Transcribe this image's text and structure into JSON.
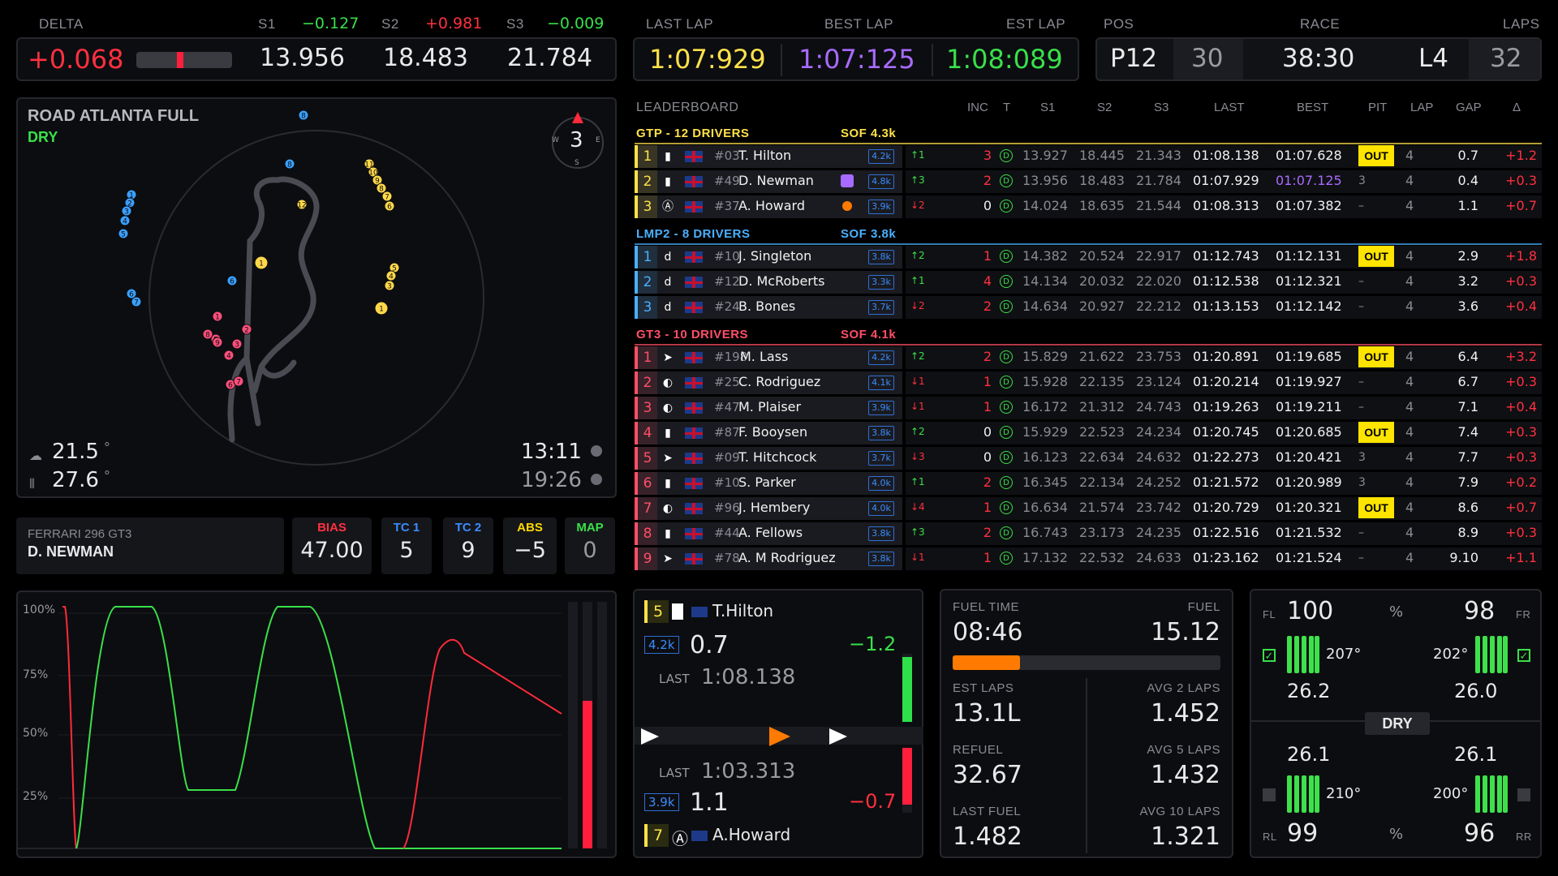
{
  "delta": {
    "label": "DELTA",
    "value": "+0.068",
    "s1_label": "S1",
    "s1_delta": "−0.127",
    "s2_label": "S2",
    "s2_delta": "+0.981",
    "s3_label": "S3",
    "s3_delta": "−0.009",
    "s1": "13.956",
    "s2": "18.483",
    "s3": "21.784"
  },
  "laps_box": {
    "last_label": "LAST LAP",
    "best_label": "BEST LAP",
    "est_label": "EST LAP",
    "last": "1:07:929",
    "best": "1:07:125",
    "est": "1:08:089"
  },
  "race_box": {
    "pos_label": "POS",
    "race_label": "RACE",
    "laps_label": "LAPS",
    "pos": "P12",
    "field": "30",
    "time": "38:30",
    "lap": "L4",
    "total_laps": "32"
  },
  "map": {
    "track": "ROAD ATLANTA FULL",
    "surface": "DRY",
    "compass_n": "N",
    "compass_w": "W",
    "compass_e": "E",
    "compass_s": "S",
    "compass_value": "3",
    "air_temp": "21.5",
    "track_temp": "27.6",
    "deg": "°",
    "clock": "13:11",
    "clock2": "19:26",
    "markers": [
      {
        "label": "8",
        "color": "#3aa0ff"
      },
      {
        "label": "8",
        "color": "#3aa0ff"
      },
      {
        "label": "1",
        "color": "#3aa0ff"
      },
      {
        "label": "2",
        "color": "#3aa0ff"
      },
      {
        "label": "3",
        "color": "#3aa0ff"
      },
      {
        "label": "4",
        "color": "#3aa0ff"
      },
      {
        "label": "5",
        "color": "#3aa0ff"
      },
      {
        "label": "6",
        "color": "#3aa0ff"
      },
      {
        "label": "7",
        "color": "#3aa0ff"
      },
      {
        "label": "6",
        "color": "#3aa0ff"
      },
      {
        "label": "12",
        "color": "#ffd84a"
      },
      {
        "label": "11",
        "color": "#ffd84a"
      },
      {
        "label": "10",
        "color": "#ffd84a"
      },
      {
        "label": "9",
        "color": "#ffd84a"
      },
      {
        "label": "8",
        "color": "#ffd84a"
      },
      {
        "label": "7",
        "color": "#ffd84a"
      },
      {
        "label": "6",
        "color": "#ffd84a"
      },
      {
        "label": "5",
        "color": "#ffd84a"
      },
      {
        "label": "4",
        "color": "#ffd84a"
      },
      {
        "label": "3",
        "color": "#ffd84a"
      },
      {
        "label": "1",
        "color": "#ffd84a"
      },
      {
        "label": "1",
        "color": "#ffd84a"
      },
      {
        "label": "1",
        "color": "#ff4f7b"
      },
      {
        "label": "2",
        "color": "#ff4f7b"
      },
      {
        "label": "3",
        "color": "#ff4f7b"
      },
      {
        "label": "4",
        "color": "#ff4f7b"
      },
      {
        "label": "5",
        "color": "#ff4f7b"
      },
      {
        "label": "6",
        "color": "#ff4f7b"
      },
      {
        "label": "7",
        "color": "#ff4f7b"
      },
      {
        "label": "8",
        "color": "#ff4f7b"
      },
      {
        "label": "9",
        "color": "#ff4f7b"
      }
    ]
  },
  "car": {
    "model": "FERRARI 296 GT3",
    "driver": "D. NEWMAN"
  },
  "settings": [
    {
      "label": "BIAS",
      "value": "47.00",
      "color": "#ff3040"
    },
    {
      "label": "TC 1",
      "value": "5",
      "color": "#3a8cff"
    },
    {
      "label": "TC 2",
      "value": "9",
      "color": "#3a8cff"
    },
    {
      "label": "ABS",
      "value": "−5",
      "color": "#ffd700"
    },
    {
      "label": "MAP",
      "value": "0",
      "color": "#39e04a"
    }
  ],
  "leaderboard": {
    "title": "LEADERBOARD",
    "cols": {
      "inc": "INC",
      "t": "T",
      "s1": "S1",
      "s2": "S2",
      "s3": "S3",
      "last": "LAST",
      "best": "BEST",
      "pit": "PIT",
      "lap": "LAP",
      "gap": "GAP",
      "delta": "Δ"
    },
    "classes": [
      {
        "name": "GTP - 12 DRIVERS",
        "sof": "SOF 4.3k",
        "color": "#ffe14a"
      },
      {
        "name": "LMP2 - 8 DRIVERS",
        "sof": "SOF 3.8k",
        "color": "#4ab0ff"
      },
      {
        "name": "GT3 - 10 DRIVERS",
        "sof": "SOF 4.1k",
        "color": "#ff4f68"
      }
    ],
    "rows": [
      {
        "cls": 0,
        "pos": "1",
        "brand": "▮",
        "num": "#03",
        "name": "T. Hilton",
        "lic": "4.2k",
        "pg": "↑1",
        "pgc": "up",
        "inc": "3",
        "incc": "#ff3040",
        "tyre": "D",
        "s1": "13.927",
        "s2": "18.445",
        "s3": "21.343",
        "last": "01:08.138",
        "best": "01:07.628",
        "pit": "OUT",
        "lap": "4",
        "gap": "0.7",
        "delta": "+1.2"
      },
      {
        "cls": 0,
        "pos": "2",
        "brand": "▮",
        "num": "#49",
        "name": "D. Newman",
        "lic": "4.8k",
        "pg": "↑3",
        "pgc": "up",
        "inc": "2",
        "incc": "#ff3040",
        "tyre": "D",
        "s1": "13.956",
        "s2": "18.483",
        "s3": "21.784",
        "last": "01:07.929",
        "best": "01:07.125",
        "pit": "3",
        "lap": "4",
        "gap": "0.4",
        "delta": "+0.3",
        "bestc": "#a86bff",
        "tag": "timer"
      },
      {
        "cls": 0,
        "pos": "3",
        "brand": "Ⓐ",
        "num": "#37",
        "name": "A. Howard",
        "lic": "3.9k",
        "pg": "↓2",
        "pgc": "down",
        "inc": "0",
        "incc": "#f2f2f2",
        "tyre": "D",
        "s1": "14.024",
        "s2": "18.635",
        "s3": "21.544",
        "last": "01:08.313",
        "best": "01:07.382",
        "pit": "–",
        "lap": "4",
        "gap": "1.1",
        "delta": "+0.7",
        "tag": "dot"
      },
      {
        "cls": 1,
        "pos": "1",
        "brand": "d",
        "num": "#10",
        "name": "J. Singleton",
        "lic": "3.8k",
        "pg": "↑2",
        "pgc": "up",
        "inc": "1",
        "incc": "#ff3040",
        "tyre": "D",
        "s1": "14.382",
        "s2": "20.524",
        "s3": "22.917",
        "last": "01:12.743",
        "best": "01:12.131",
        "pit": "OUT",
        "lap": "4",
        "gap": "2.9",
        "delta": "+1.8"
      },
      {
        "cls": 1,
        "pos": "2",
        "brand": "d",
        "num": "#12",
        "name": "D. McRoberts",
        "lic": "3.3k",
        "pg": "↑1",
        "pgc": "up",
        "inc": "4",
        "incc": "#ff3040",
        "tyre": "D",
        "s1": "14.134",
        "s2": "20.032",
        "s3": "22.020",
        "last": "01:12.538",
        "best": "01:12.321",
        "pit": "–",
        "lap": "4",
        "gap": "3.2",
        "delta": "+0.3"
      },
      {
        "cls": 1,
        "pos": "3",
        "brand": "d",
        "num": "#24",
        "name": "B. Bones",
        "lic": "3.7k",
        "pg": "↓2",
        "pgc": "down",
        "inc": "2",
        "incc": "#ff3040",
        "tyre": "D",
        "s1": "14.634",
        "s2": "20.927",
        "s3": "22.212",
        "last": "01:13.153",
        "best": "01:12.142",
        "pit": "–",
        "lap": "4",
        "gap": "3.6",
        "delta": "+0.4"
      },
      {
        "cls": 2,
        "pos": "1",
        "brand": "➤",
        "num": "#198",
        "name": "M. Lass",
        "lic": "4.2k",
        "pg": "↑2",
        "pgc": "up",
        "inc": "2",
        "incc": "#ff3040",
        "tyre": "D",
        "s1": "15.829",
        "s2": "21.622",
        "s3": "23.753",
        "last": "01:20.891",
        "best": "01:19.685",
        "pit": "OUT",
        "lap": "4",
        "gap": "6.4",
        "delta": "+3.2"
      },
      {
        "cls": 2,
        "pos": "2",
        "brand": "◐",
        "num": "#25",
        "name": "C. Rodriguez",
        "lic": "4.1k",
        "pg": "↓1",
        "pgc": "down",
        "inc": "1",
        "incc": "#ff3040",
        "tyre": "D",
        "s1": "15.928",
        "s2": "22.135",
        "s3": "23.124",
        "last": "01:20.214",
        "best": "01:19.927",
        "pit": "–",
        "lap": "4",
        "gap": "6.7",
        "delta": "+0.3"
      },
      {
        "cls": 2,
        "pos": "3",
        "brand": "◐",
        "num": "#47",
        "name": "M. Plaiser",
        "lic": "3.9k",
        "pg": "↓1",
        "pgc": "down",
        "inc": "1",
        "incc": "#ff3040",
        "tyre": "D",
        "s1": "16.172",
        "s2": "21.312",
        "s3": "24.743",
        "last": "01:19.263",
        "best": "01:19.211",
        "pit": "–",
        "lap": "4",
        "gap": "7.1",
        "delta": "+0.4"
      },
      {
        "cls": 2,
        "pos": "4",
        "brand": "▮",
        "num": "#87",
        "name": "F. Booysen",
        "lic": "3.8k",
        "pg": "↑2",
        "pgc": "up",
        "inc": "0",
        "incc": "#f2f2f2",
        "tyre": "D",
        "s1": "15.929",
        "s2": "22.523",
        "s3": "24.234",
        "last": "01:20.745",
        "best": "01:20.685",
        "pit": "OUT",
        "lap": "4",
        "gap": "7.4",
        "delta": "+0.3"
      },
      {
        "cls": 2,
        "pos": "5",
        "brand": "➤",
        "num": "#09",
        "name": "T. Hitchcock",
        "lic": "3.7k",
        "pg": "↓3",
        "pgc": "down",
        "inc": "0",
        "incc": "#f2f2f2",
        "tyre": "D",
        "s1": "16.123",
        "s2": "22.634",
        "s3": "24.632",
        "last": "01:22.273",
        "best": "01:20.421",
        "pit": "3",
        "lap": "4",
        "gap": "7.7",
        "delta": "+0.3"
      },
      {
        "cls": 2,
        "pos": "6",
        "brand": "▮",
        "num": "#10",
        "name": "S. Parker",
        "lic": "4.0k",
        "pg": "↑1",
        "pgc": "up",
        "inc": "2",
        "incc": "#ff3040",
        "tyre": "D",
        "s1": "16.345",
        "s2": "22.134",
        "s3": "24.252",
        "last": "01:21.572",
        "best": "01:20.989",
        "pit": "3",
        "lap": "4",
        "gap": "7.9",
        "delta": "+0.2"
      },
      {
        "cls": 2,
        "pos": "7",
        "brand": "◐",
        "num": "#96",
        "name": "J. Hembery",
        "lic": "4.0k",
        "pg": "↓4",
        "pgc": "down",
        "inc": "1",
        "incc": "#ff3040",
        "tyre": "D",
        "s1": "16.634",
        "s2": "21.574",
        "s3": "23.742",
        "last": "01:20.729",
        "best": "01:20.321",
        "pit": "OUT",
        "lap": "4",
        "gap": "8.6",
        "delta": "+0.7"
      },
      {
        "cls": 2,
        "pos": "8",
        "brand": "▮",
        "num": "#44",
        "name": "A. Fellows",
        "lic": "3.8k",
        "pg": "↑3",
        "pgc": "up",
        "inc": "2",
        "incc": "#ff3040",
        "tyre": "D",
        "s1": "16.743",
        "s2": "23.173",
        "s3": "24.235",
        "last": "01:22.516",
        "best": "01:21.532",
        "pit": "–",
        "lap": "4",
        "gap": "8.9",
        "delta": "+0.3"
      },
      {
        "cls": 2,
        "pos": "9",
        "brand": "➤",
        "num": "#78",
        "name": "A. M Rodriguez",
        "lic": "3.8k",
        "pg": "↓1",
        "pgc": "down",
        "inc": "1",
        "incc": "#ff3040",
        "tyre": "D",
        "s1": "17.132",
        "s2": "22.532",
        "s3": "24.633",
        "last": "01:23.162",
        "best": "01:21.524",
        "pit": "–",
        "lap": "4",
        "gap": "9.10",
        "delta": "+1.1"
      }
    ]
  },
  "relative": {
    "ahead": {
      "pos": "5",
      "name": "T.Hilton",
      "lic": "4.2k",
      "gap": "0.7",
      "delta": "−1.2",
      "last_label": "LAST",
      "last": "1:08.138"
    },
    "behind": {
      "pos": "7",
      "name": "A.Howard",
      "lic": "3.9k",
      "gap": "1.1",
      "delta": "−0.7",
      "last_label": "LAST",
      "last": "1:03.313"
    }
  },
  "fuel": {
    "time_label": "FUEL TIME",
    "time": "08:46",
    "fuel_label": "FUEL",
    "fuel": "15.12",
    "fuel_fraction": 0.25,
    "est_label": "EST LAPS",
    "est": "13.1L",
    "avg2_label": "AVG 2 LAPS",
    "avg2": "1.452",
    "refuel_label": "REFUEL",
    "refuel": "32.67",
    "avg5_label": "AVG 5 LAPS",
    "avg5": "1.432",
    "lastfuel_label": "LAST FUEL",
    "lastfuel": "1.482",
    "avg10_label": "AVG 10 LAPS",
    "avg10": "1.321"
  },
  "tyres": {
    "fl_label": "FL",
    "fr_label": "FR",
    "rl_label": "RL",
    "rr_label": "RR",
    "pct": "%",
    "fl": "100",
    "fr": "98",
    "rl": "99",
    "rr": "96",
    "fl_temp": "207°",
    "fr_temp": "202°",
    "rl_temp": "210°",
    "rr_temp": "200°",
    "fl_p": "26.2",
    "fr_p": "26.0",
    "rl_p": "26.1",
    "rr_p": "26.1",
    "surface": "DRY"
  },
  "telemetry": {
    "ticks": [
      "100%",
      "75%",
      "50%",
      "25%"
    ],
    "brake_fraction": 0.6
  },
  "colors": {
    "accent_yellow": "#ffe14a",
    "accent_purple": "#a86bff",
    "accent_green": "#39e04a",
    "accent_red": "#ff3040",
    "accent_blue": "#3a8cff",
    "accent_orange": "#ff7a00"
  }
}
